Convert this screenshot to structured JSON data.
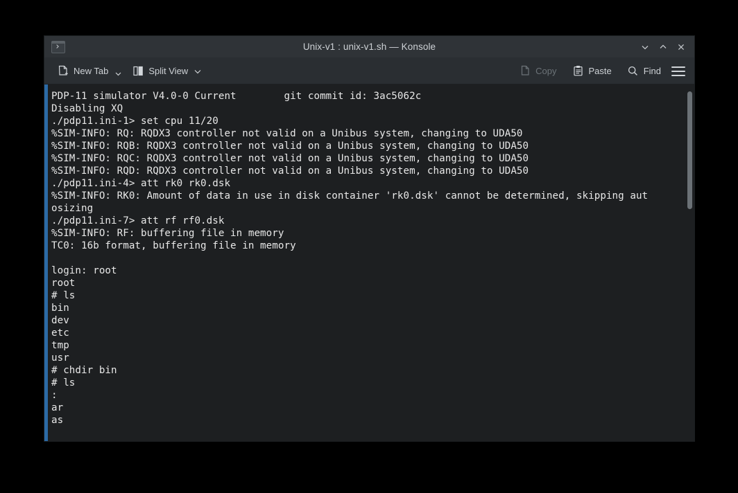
{
  "window": {
    "title": "Unix-v1 : unix-v1.sh — Konsole",
    "app_icon": "terminal-prompt-icon",
    "controls": {
      "minimize": "minimize-icon",
      "maximize": "maximize-icon",
      "close": "close-icon"
    },
    "accent_color": "#2b6aa6",
    "titlebar_color": "#2f3337",
    "toolbar_color": "#2a2e32",
    "terminal_bg": "#1d1f21",
    "terminal_fg": "#e8e8e8"
  },
  "toolbar": {
    "new_tab_label": "New Tab",
    "new_tab_icon": "new-tab-icon",
    "new_tab_caret": "chevron-down-icon",
    "split_view_label": "Split View",
    "split_view_icon": "split-view-icon",
    "split_view_caret": "chevron-down-icon",
    "copy_label": "Copy",
    "copy_icon": "copy-icon",
    "copy_enabled": false,
    "paste_label": "Paste",
    "paste_icon": "paste-icon",
    "paste_enabled": true,
    "find_label": "Find",
    "find_icon": "search-icon",
    "find_enabled": true,
    "menu_icon": "hamburger-menu-icon"
  },
  "terminal": {
    "scrollbar": {
      "thumb_top_pct": 2,
      "thumb_height_pct": 33
    },
    "lines": [
      "PDP-11 simulator V4.0-0 Current        git commit id: 3ac5062c",
      "Disabling XQ",
      "./pdp11.ini-1> set cpu 11/20",
      "%SIM-INFO: RQ: RQDX3 controller not valid on a Unibus system, changing to UDA50",
      "%SIM-INFO: RQB: RQDX3 controller not valid on a Unibus system, changing to UDA50",
      "%SIM-INFO: RQC: RQDX3 controller not valid on a Unibus system, changing to UDA50",
      "%SIM-INFO: RQD: RQDX3 controller not valid on a Unibus system, changing to UDA50",
      "./pdp11.ini-4> att rk0 rk0.dsk",
      "%SIM-INFO: RK0: Amount of data in use in disk container 'rk0.dsk' cannot be determined, skipping aut",
      "osizing",
      "./pdp11.ini-7> att rf rf0.dsk",
      "%SIM-INFO: RF: buffering file in memory",
      "TC0: 16b format, buffering file in memory",
      "",
      "login: root",
      "root",
      "# ls",
      "bin",
      "dev",
      "etc",
      "tmp",
      "usr",
      "# chdir bin",
      "# ls",
      ":",
      "ar",
      "as"
    ]
  }
}
